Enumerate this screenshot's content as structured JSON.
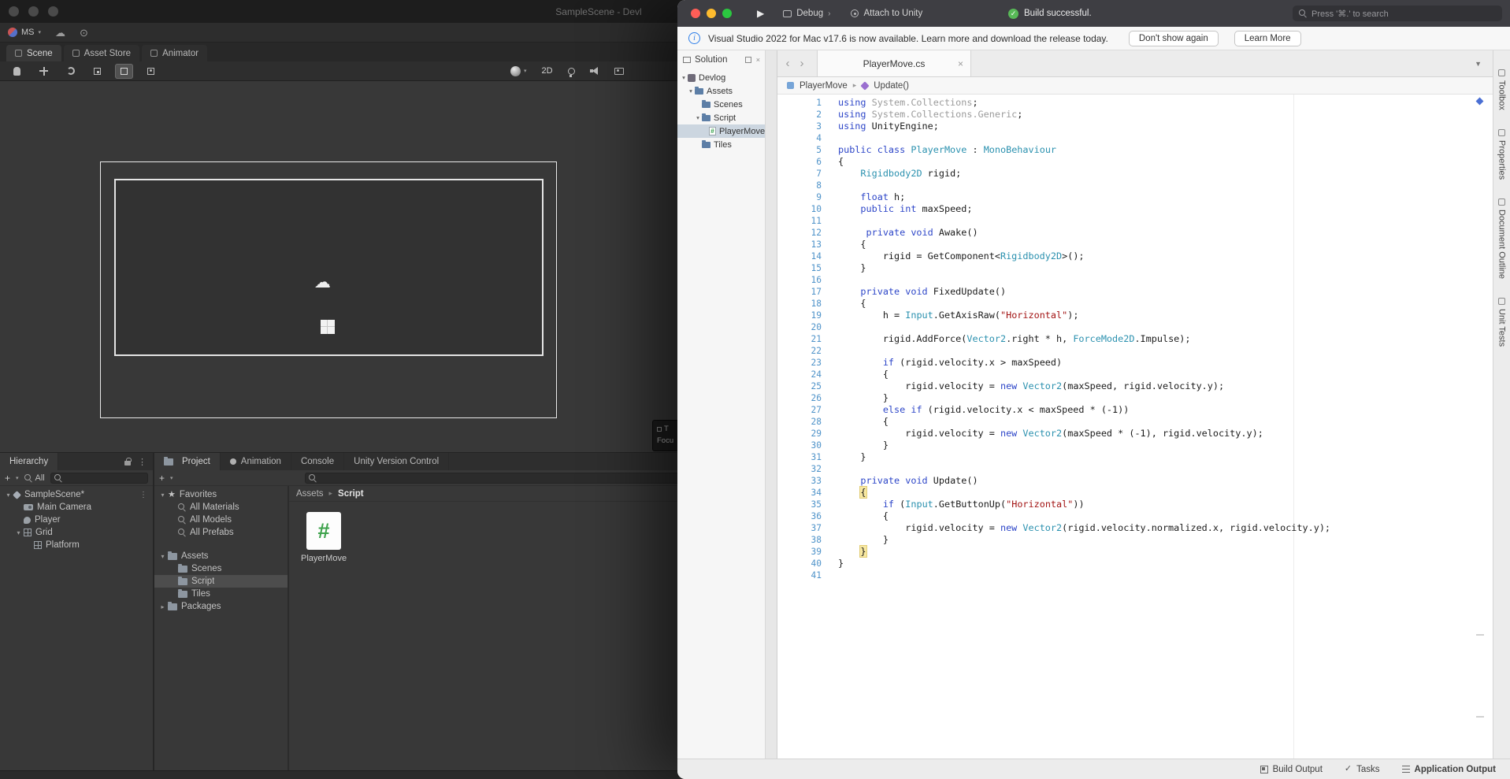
{
  "unity": {
    "titlebar": {
      "title": "SampleScene - Devl"
    },
    "menubar": {
      "account_label": "MS",
      "tabs": [
        {
          "label": "Scene"
        },
        {
          "label": "Asset Store"
        },
        {
          "label": "Animator"
        }
      ]
    },
    "scene_toolbar": {
      "tools": [
        {
          "name": "view-tool"
        },
        {
          "name": "move-tool"
        },
        {
          "name": "rotate-tool"
        },
        {
          "name": "scale-tool"
        },
        {
          "name": "rect-tool",
          "active": true
        },
        {
          "name": "transform-tool"
        }
      ],
      "mode_2d": "2D"
    },
    "scene_popup": {
      "lines": [
        "T",
        "Focu"
      ]
    },
    "hierarchy": {
      "title": "Hierarchy",
      "add_label": "+",
      "filter_label": "All",
      "rows": [
        {
          "label": "SampleScene*",
          "icon": "scene",
          "depth": 0,
          "expander": "open",
          "menu": true
        },
        {
          "label": "Main Camera",
          "icon": "camera",
          "depth": 1
        },
        {
          "label": "Player",
          "icon": "sprite",
          "depth": 1
        },
        {
          "label": "Grid",
          "icon": "grid",
          "depth": 1,
          "expander": "open"
        },
        {
          "label": "Platform",
          "icon": "grid",
          "depth": 2
        }
      ]
    },
    "project": {
      "tabs": [
        {
          "label": "Project",
          "icon": "folder",
          "active": true
        },
        {
          "label": "Animation",
          "icon": "dot"
        },
        {
          "label": "Console"
        },
        {
          "label": "Unity Version Control"
        }
      ],
      "add_label": "+",
      "tree": [
        {
          "label": "Favorites",
          "icon": "star",
          "depth": 0,
          "expander": "open"
        },
        {
          "label": "All Materials",
          "icon": "search",
          "depth": 1
        },
        {
          "label": "All Models",
          "icon": "search",
          "depth": 1
        },
        {
          "label": "All Prefabs",
          "icon": "search",
          "depth": 1
        },
        {
          "label": "Assets",
          "icon": "folder",
          "depth": 0,
          "expander": "open",
          "section_gap": true
        },
        {
          "label": "Scenes",
          "icon": "folder",
          "depth": 1
        },
        {
          "label": "Script",
          "icon": "folder",
          "depth": 1,
          "selected": true
        },
        {
          "label": "Tiles",
          "icon": "folder",
          "depth": 1
        },
        {
          "label": "Packages",
          "icon": "folder",
          "depth": 0,
          "expander": "closed"
        }
      ],
      "breadcrumb": {
        "root": "Assets",
        "current": "Script"
      },
      "items": [
        {
          "label": "PlayerMove",
          "badge": "#"
        }
      ]
    }
  },
  "vs": {
    "titlebar": {
      "target_label": "Debug",
      "attach_label": "Attach to Unity",
      "status": "Build successful.",
      "search_placeholder": "Press '⌘.' to search"
    },
    "notification": {
      "info_glyph": "i",
      "text": "Visual Studio 2022 for Mac v17.6 is now available. Learn more and download the release today.",
      "dismiss_label": "Don't show again",
      "learn_label": "Learn More"
    },
    "solution": {
      "title": "Solution",
      "tree": [
        {
          "label": "Devlog",
          "icon": "solution",
          "depth": 0,
          "expander": "open"
        },
        {
          "label": "Assets",
          "icon": "folder",
          "depth": 1,
          "expander": "open"
        },
        {
          "label": "Scenes",
          "icon": "folder",
          "depth": 2
        },
        {
          "label": "Script",
          "icon": "folder",
          "depth": 2,
          "expander": "open"
        },
        {
          "label": "PlayerMove",
          "icon": "csfile",
          "depth": 3,
          "selected": true
        },
        {
          "label": "Tiles",
          "icon": "folder",
          "depth": 2
        }
      ]
    },
    "editor": {
      "tab_title": "PlayerMove.cs",
      "breadcrumb": [
        {
          "label": "PlayerMove",
          "icon": "class"
        },
        {
          "label": "Update()",
          "icon": "method"
        }
      ]
    },
    "code": {
      "lines": [
        [
          {
            "t": "k",
            "v": "using"
          },
          {
            "t": "f",
            "v": " System.Collections"
          },
          {
            "t": "p",
            "v": ";"
          }
        ],
        [
          {
            "t": "k",
            "v": "using"
          },
          {
            "t": "f",
            "v": " System.Collections.Generic"
          },
          {
            "t": "p",
            "v": ";"
          }
        ],
        [
          {
            "t": "k",
            "v": "using"
          },
          {
            "t": "p",
            "v": " UnityEngine;"
          }
        ],
        [],
        [
          {
            "t": "k",
            "v": "public class "
          },
          {
            "t": "ty",
            "v": "PlayerMove"
          },
          {
            "t": "p",
            "v": " : "
          },
          {
            "t": "ty",
            "v": "MonoBehaviour"
          }
        ],
        [
          {
            "t": "p",
            "v": "{"
          }
        ],
        [
          {
            "t": "p",
            "v": "    "
          },
          {
            "t": "ty",
            "v": "Rigidbody2D"
          },
          {
            "t": "p",
            "v": " rigid;"
          }
        ],
        [],
        [
          {
            "t": "p",
            "v": "    "
          },
          {
            "t": "k",
            "v": "float"
          },
          {
            "t": "p",
            "v": " h;"
          }
        ],
        [
          {
            "t": "p",
            "v": "    "
          },
          {
            "t": "k",
            "v": "public int"
          },
          {
            "t": "p",
            "v": " maxSpeed;"
          }
        ],
        [],
        [
          {
            "t": "p",
            "v": "     "
          },
          {
            "t": "k",
            "v": "private void"
          },
          {
            "t": "p",
            "v": " Awake()"
          }
        ],
        [
          {
            "t": "p",
            "v": "    {"
          }
        ],
        [
          {
            "t": "p",
            "v": "        rigid = GetComponent<"
          },
          {
            "t": "ty",
            "v": "Rigidbody2D"
          },
          {
            "t": "p",
            "v": ">();"
          }
        ],
        [
          {
            "t": "p",
            "v": "    }"
          }
        ],
        [],
        [
          {
            "t": "p",
            "v": "    "
          },
          {
            "t": "k",
            "v": "private void"
          },
          {
            "t": "p",
            "v": " FixedUpdate()"
          }
        ],
        [
          {
            "t": "p",
            "v": "    {"
          }
        ],
        [
          {
            "t": "p",
            "v": "        h = "
          },
          {
            "t": "ty",
            "v": "Input"
          },
          {
            "t": "p",
            "v": ".GetAxisRaw("
          },
          {
            "t": "s",
            "v": "\"Horizontal\""
          },
          {
            "t": "p",
            "v": ");"
          }
        ],
        [],
        [
          {
            "t": "p",
            "v": "        rigid.AddForce("
          },
          {
            "t": "ty",
            "v": "Vector2"
          },
          {
            "t": "p",
            "v": ".right * h, "
          },
          {
            "t": "ty",
            "v": "ForceMode2D"
          },
          {
            "t": "p",
            "v": ".Impulse);"
          }
        ],
        [],
        [
          {
            "t": "p",
            "v": "        "
          },
          {
            "t": "k",
            "v": "if"
          },
          {
            "t": "p",
            "v": " (rigid.velocity.x > maxSpeed)"
          }
        ],
        [
          {
            "t": "p",
            "v": "        {"
          }
        ],
        [
          {
            "t": "p",
            "v": "            rigid.velocity = "
          },
          {
            "t": "k",
            "v": "new"
          },
          {
            "t": "p",
            "v": " "
          },
          {
            "t": "ty",
            "v": "Vector2"
          },
          {
            "t": "p",
            "v": "(maxSpeed, rigid.velocity.y);"
          }
        ],
        [
          {
            "t": "p",
            "v": "        }"
          }
        ],
        [
          {
            "t": "p",
            "v": "        "
          },
          {
            "t": "k",
            "v": "else if"
          },
          {
            "t": "p",
            "v": " (rigid.velocity.x < maxSpeed * (-1))"
          }
        ],
        [
          {
            "t": "p",
            "v": "        {"
          }
        ],
        [
          {
            "t": "p",
            "v": "            rigid.velocity = "
          },
          {
            "t": "k",
            "v": "new"
          },
          {
            "t": "p",
            "v": " "
          },
          {
            "t": "ty",
            "v": "Vector2"
          },
          {
            "t": "p",
            "v": "(maxSpeed * (-1), rigid.velocity.y);"
          }
        ],
        [
          {
            "t": "p",
            "v": "        }"
          }
        ],
        [
          {
            "t": "p",
            "v": "    }"
          }
        ],
        [],
        [
          {
            "t": "p",
            "v": "    "
          },
          {
            "t": "k",
            "v": "private void"
          },
          {
            "t": "p",
            "v": " Update()"
          }
        ],
        [
          {
            "t": "p",
            "v": "    "
          },
          {
            "t": "hl",
            "v": "{"
          }
        ],
        [
          {
            "t": "p",
            "v": "        "
          },
          {
            "t": "k",
            "v": "if"
          },
          {
            "t": "p",
            "v": " ("
          },
          {
            "t": "ty",
            "v": "Input"
          },
          {
            "t": "p",
            "v": ".GetButtonUp("
          },
          {
            "t": "s",
            "v": "\"Horizontal\""
          },
          {
            "t": "p",
            "v": "))"
          }
        ],
        [
          {
            "t": "p",
            "v": "        {"
          }
        ],
        [
          {
            "t": "p",
            "v": "            rigid.velocity = "
          },
          {
            "t": "k",
            "v": "new"
          },
          {
            "t": "p",
            "v": " "
          },
          {
            "t": "ty",
            "v": "Vector2"
          },
          {
            "t": "p",
            "v": "(rigid.velocity.normalized.x, rigid.velocity.y);"
          }
        ],
        [
          {
            "t": "p",
            "v": "        }"
          }
        ],
        [
          {
            "t": "p",
            "v": "    "
          },
          {
            "t": "hl",
            "v": "}"
          }
        ],
        [
          {
            "t": "p",
            "v": "}"
          }
        ],
        []
      ]
    },
    "status_items": [
      {
        "label": "Build Output",
        "icon": "build"
      },
      {
        "label": "Tasks",
        "icon": "check"
      },
      {
        "label": "Application Output",
        "icon": "list",
        "strong": true
      }
    ],
    "right_tabs": [
      "Toolbox",
      "Properties",
      "Document Outline",
      "Unit Tests"
    ],
    "colors": {
      "accent_blue": "#2d46c8",
      "type_teal": "#2b91af",
      "string_red": "#a31515",
      "build_ok_green": "#58b957"
    }
  }
}
